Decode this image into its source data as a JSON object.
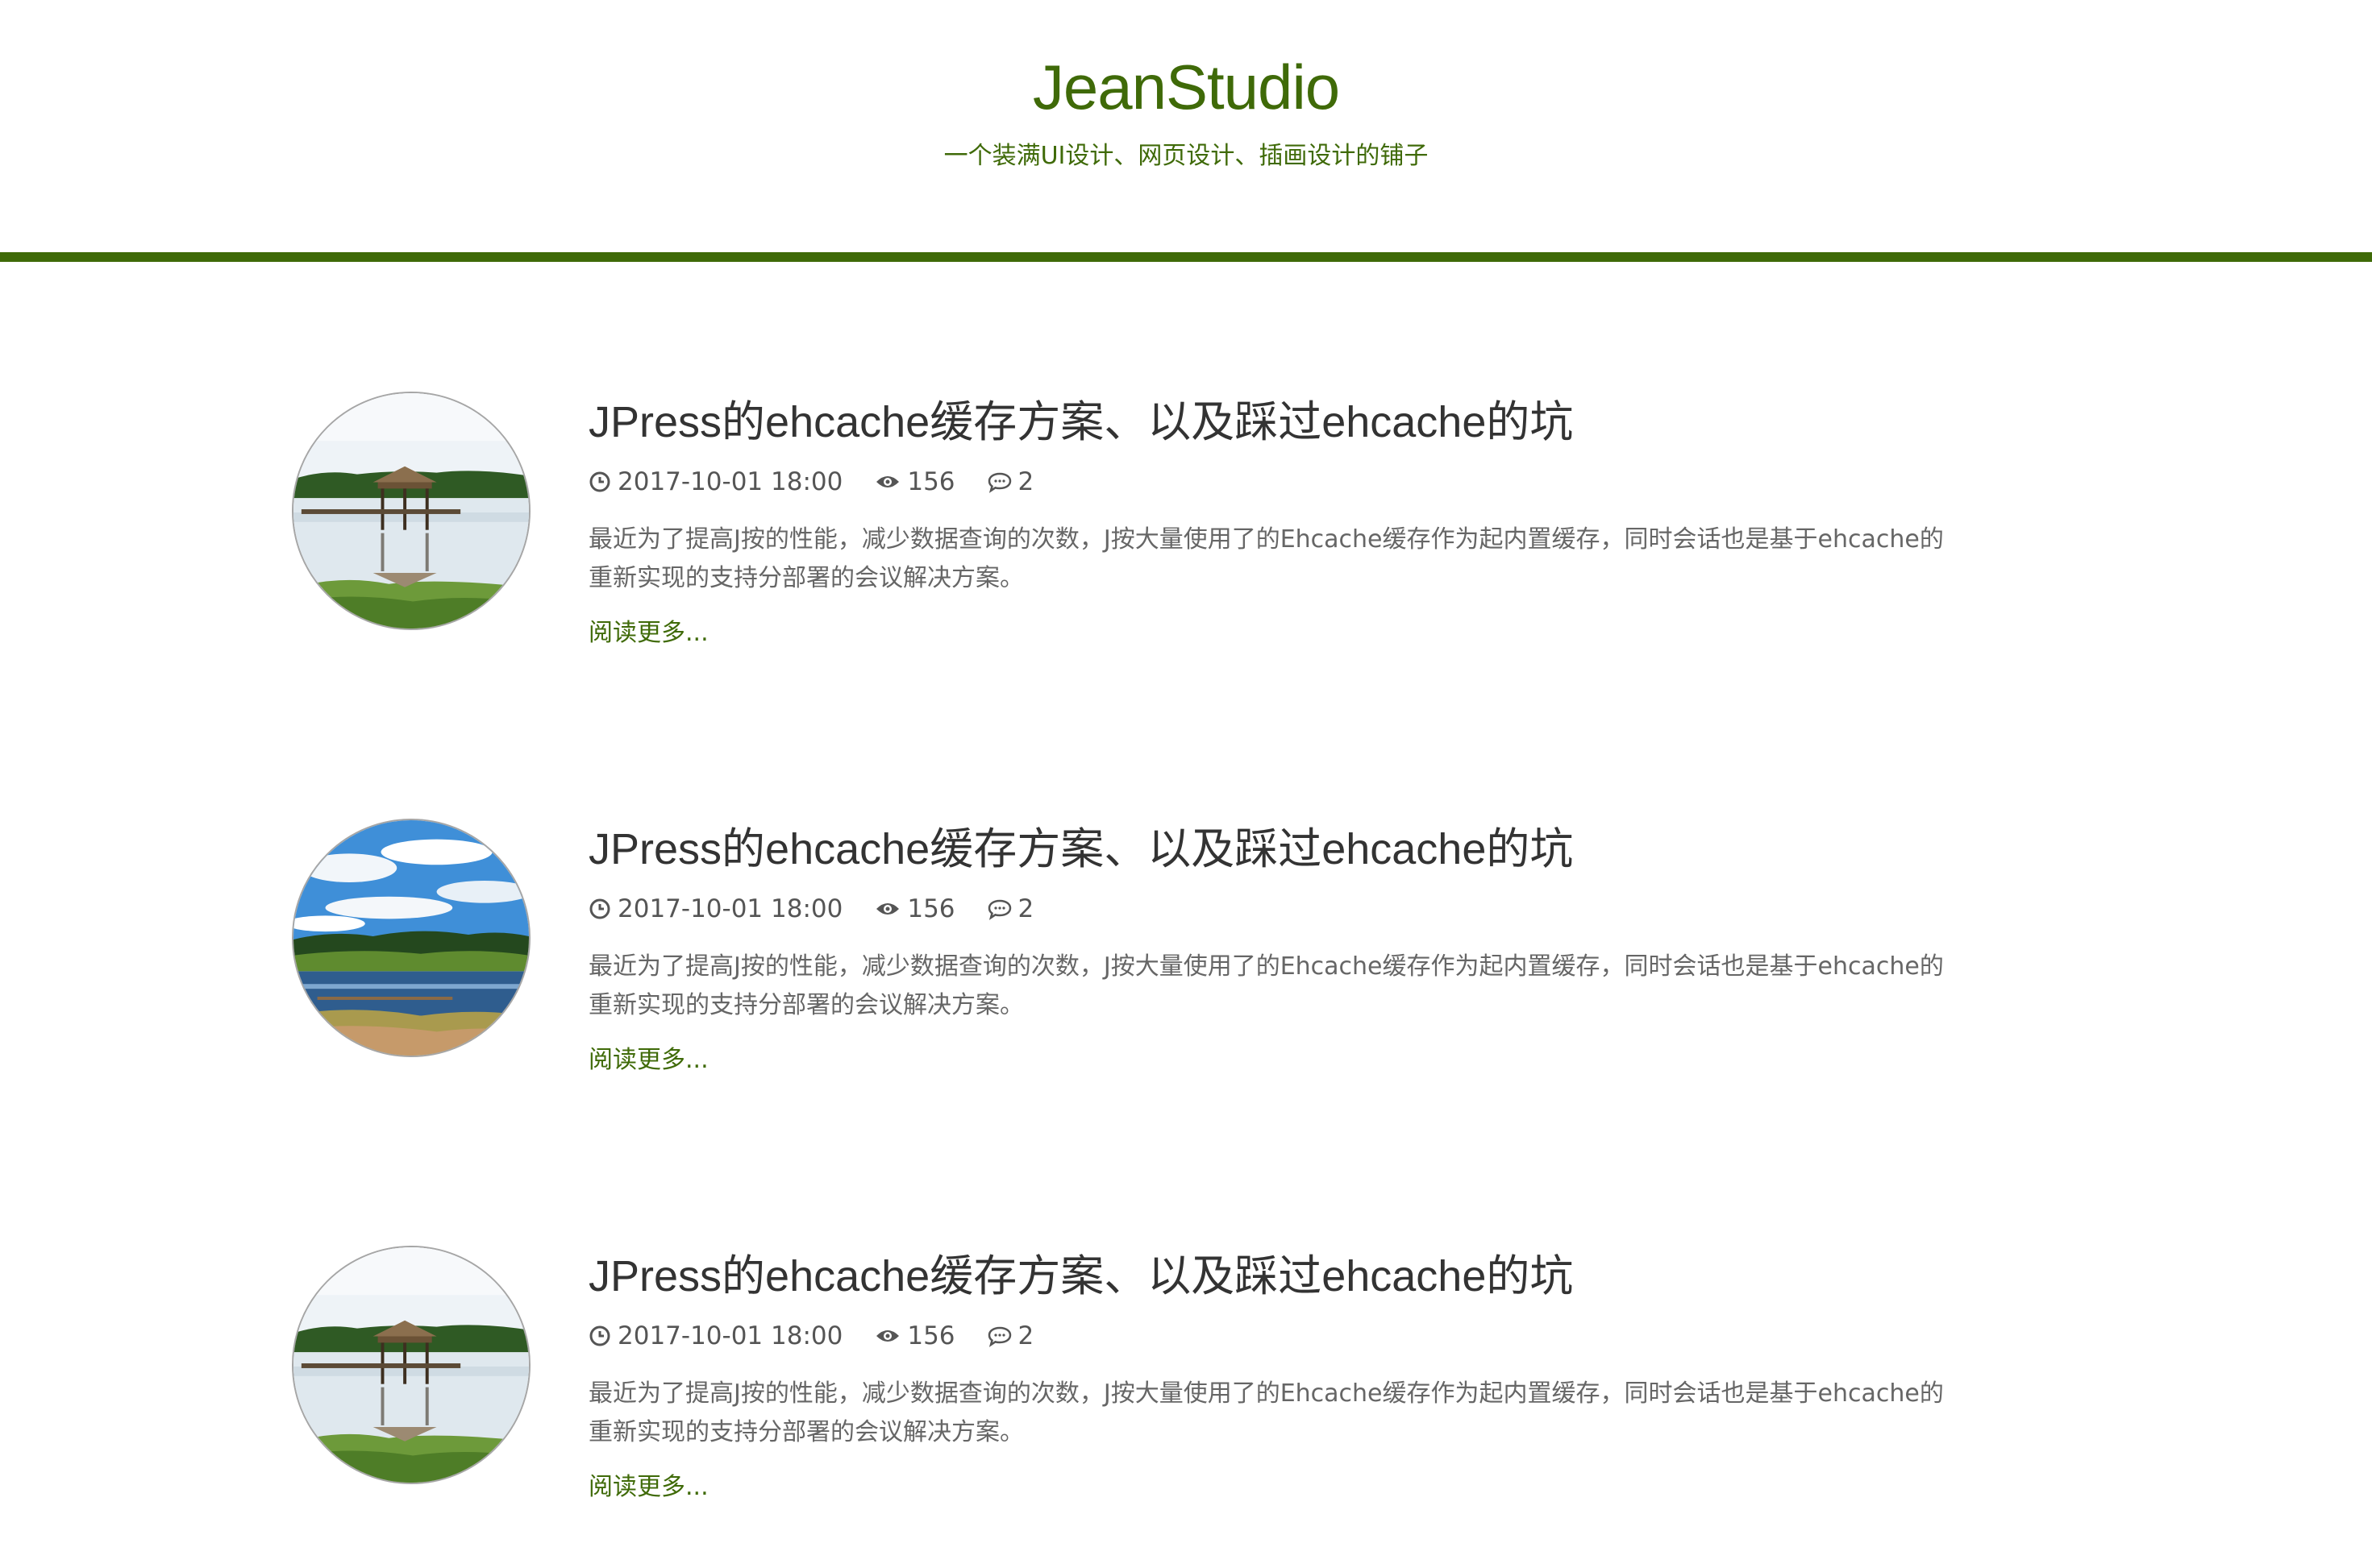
{
  "site": {
    "title": "JeanStudio",
    "subtitle": "一个装满UI设计、网页设计、插画设计的铺子",
    "accent_color": "#3f6a08"
  },
  "posts": [
    {
      "thumbnail": "gazebo-on-lake-photo",
      "title": "JPress的ehcache缓存方案、以及踩过ehcache的坑",
      "date": "2017-10-01 18:00",
      "views": "156",
      "comments": "2",
      "excerpt_line1": "最近为了提高J按的性能，减少数据查询的次数，J按大量使用了的Ehcache缓存作为起内置缓存，同时会话也是基于ehcache的",
      "excerpt_line2": "重新实现的支持分部署的会议解决方案。",
      "read_more": "阅读更多..."
    },
    {
      "thumbnail": "lake-and-sky-photo",
      "title": "JPress的ehcache缓存方案、以及踩过ehcache的坑",
      "date": "2017-10-01 18:00",
      "views": "156",
      "comments": "2",
      "excerpt_line1": "最近为了提高J按的性能，减少数据查询的次数，J按大量使用了的Ehcache缓存作为起内置缓存，同时会话也是基于ehcache的",
      "excerpt_line2": "重新实现的支持分部署的会议解决方案。",
      "read_more": "阅读更多..."
    },
    {
      "thumbnail": "gazebo-on-lake-photo",
      "title": "JPress的ehcache缓存方案、以及踩过ehcache的坑",
      "date": "2017-10-01 18:00",
      "views": "156",
      "comments": "2",
      "excerpt_line1": "最近为了提高J按的性能，减少数据查询的次数，J按大量使用了的Ehcache缓存作为起内置缓存，同时会话也是基于ehcache的",
      "excerpt_line2": "重新实现的支持分部署的会议解决方案。",
      "read_more": "阅读更多..."
    }
  ]
}
